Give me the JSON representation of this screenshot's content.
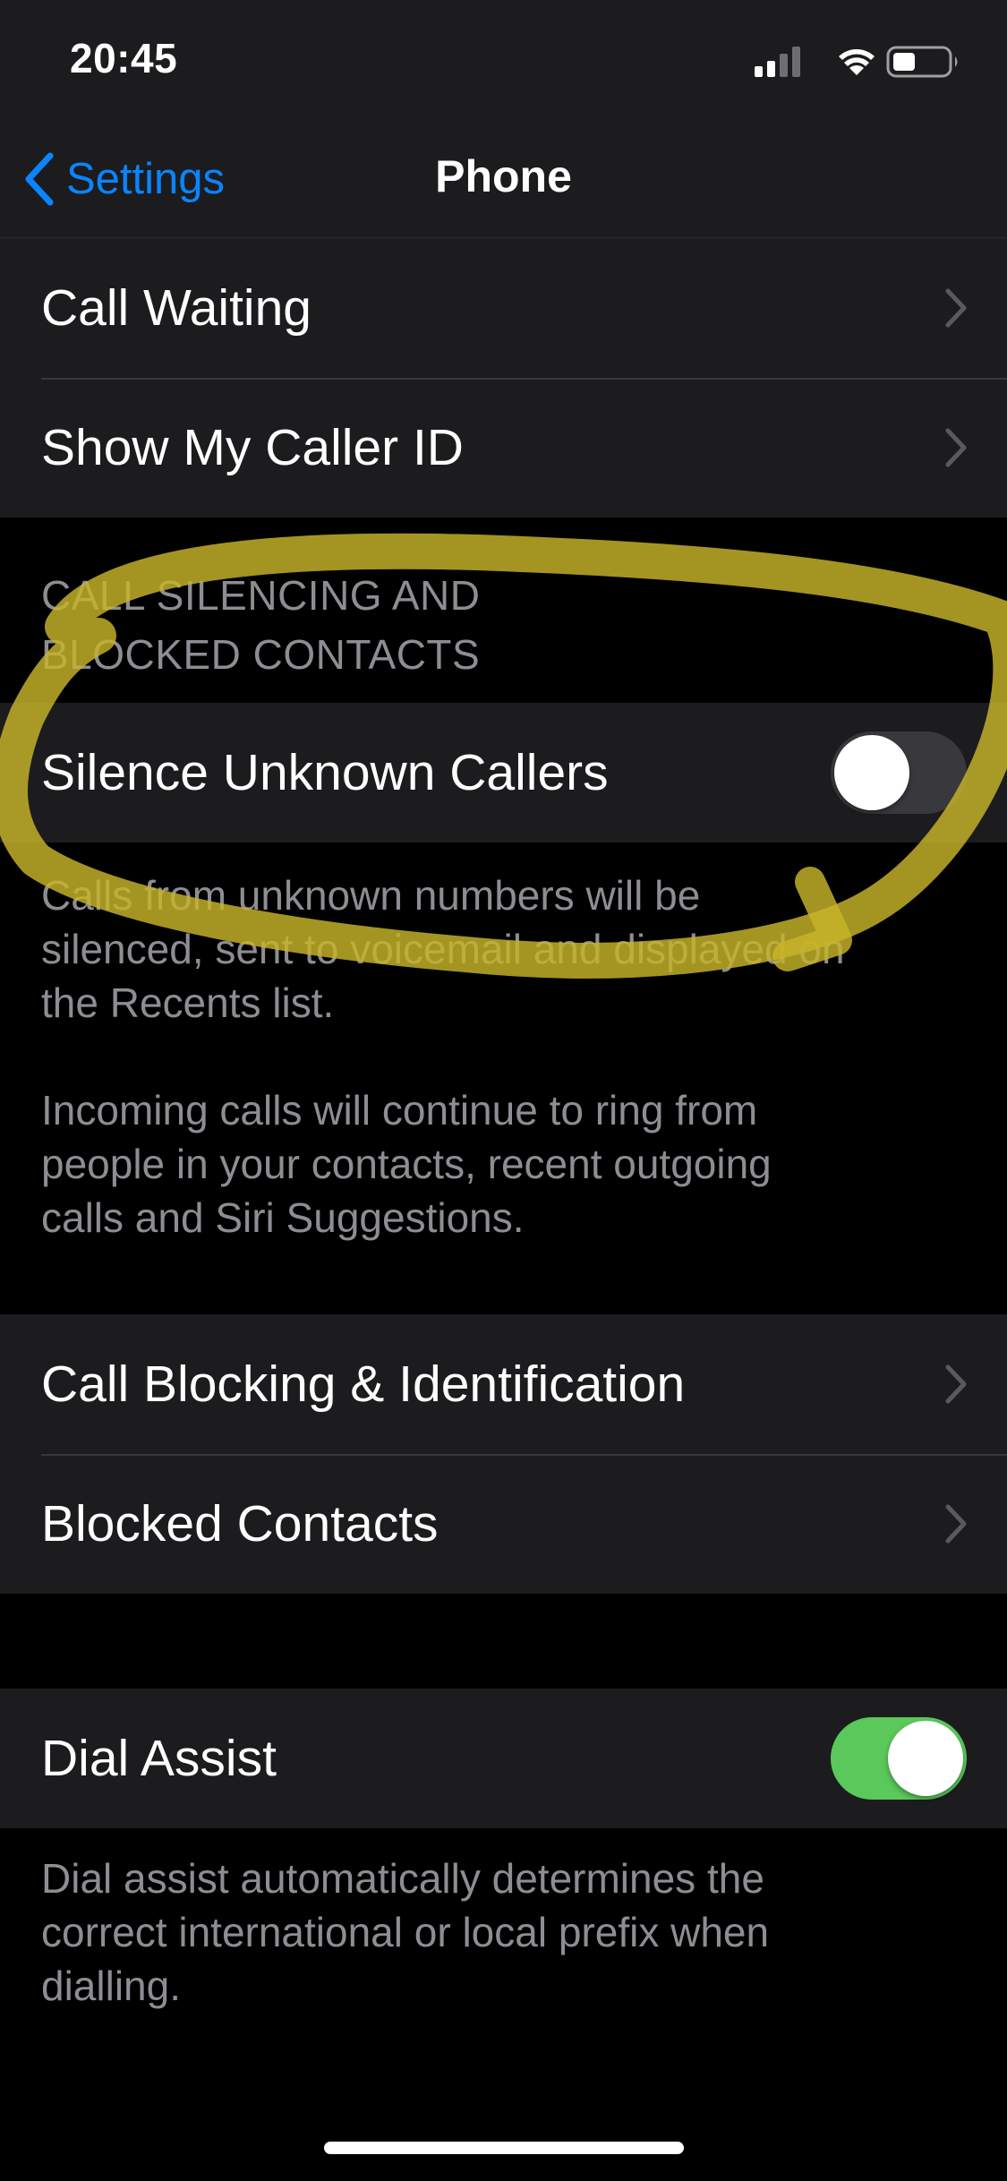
{
  "status_bar": {
    "time": "20:45",
    "icons": [
      "cellular-signal-icon",
      "wifi-icon",
      "battery-icon"
    ]
  },
  "nav": {
    "back_label": "Settings",
    "title": "Phone"
  },
  "group_calls": [
    {
      "label": "Call Waiting",
      "accessory": "chevron"
    },
    {
      "label": "Show My Caller ID",
      "accessory": "chevron"
    }
  ],
  "silencing": {
    "header_line1": "CALL SILENCING AND",
    "header_line2": "BLOCKED CONTACTS",
    "silence_unknown": {
      "label": "Silence Unknown Callers",
      "enabled": false
    },
    "footer_p1_line1": "Calls from unknown numbers will be",
    "footer_p1_line2": "silenced, sent to voicemail and displayed on",
    "footer_p1_line3": "the Recents list.",
    "footer_p2_line1": "Incoming calls will continue to ring from",
    "footer_p2_line2": "people in your contacts, recent outgoing",
    "footer_p2_line3": "calls and Siri Suggestions."
  },
  "group_blocking": [
    {
      "label": "Call Blocking & Identification",
      "accessory": "chevron"
    },
    {
      "label": "Blocked Contacts",
      "accessory": "chevron"
    }
  ],
  "dial_assist": {
    "label": "Dial Assist",
    "enabled": true,
    "footer_line1": "Dial assist automatically determines the",
    "footer_line2": "correct international or local prefix when",
    "footer_line3": "dialling."
  },
  "colors": {
    "accent": "#0a84ff",
    "toggle_on": "#5ac85a",
    "toggle_off": "#39393d",
    "cell_background": "#1c1c1e",
    "secondary_text": "#8d8d93",
    "highlight_annotation": "#c8b42a"
  },
  "annotation": {
    "type": "hand-drawn circle",
    "target": "Silence Unknown Callers"
  }
}
